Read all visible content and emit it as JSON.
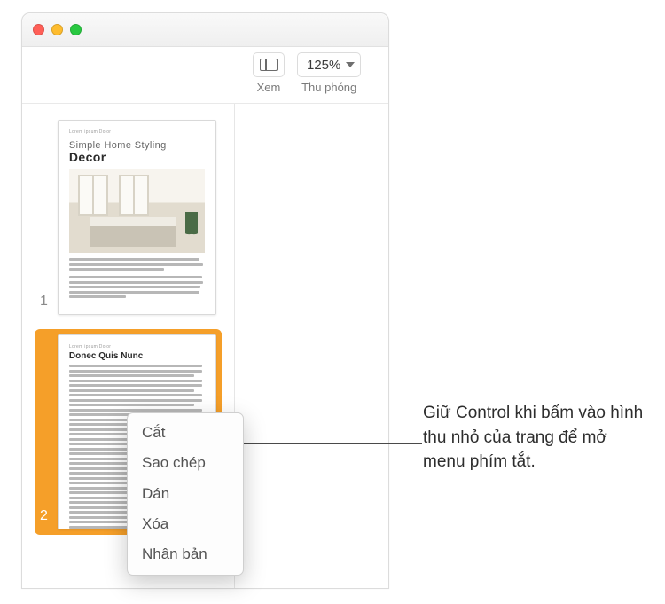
{
  "toolbar": {
    "view_label": "Xem",
    "zoom_value": "125%",
    "zoom_label": "Thu phóng"
  },
  "sidebar": {
    "pages": [
      {
        "num": "1",
        "meta": "Lorem ipsum Dolor",
        "title_small": "Simple Home Styling",
        "title_big": "Decor"
      },
      {
        "num": "2",
        "meta": "Lorem ipsum Dolor",
        "heading": "Donec Quis Nunc"
      }
    ]
  },
  "context_menu": {
    "items": [
      "Cắt",
      "Sao chép",
      "Dán",
      "Xóa",
      "Nhân bản"
    ]
  },
  "callout": "Giữ Control khi bấm vào hình thu nhỏ của trang để mở menu phím tắt."
}
